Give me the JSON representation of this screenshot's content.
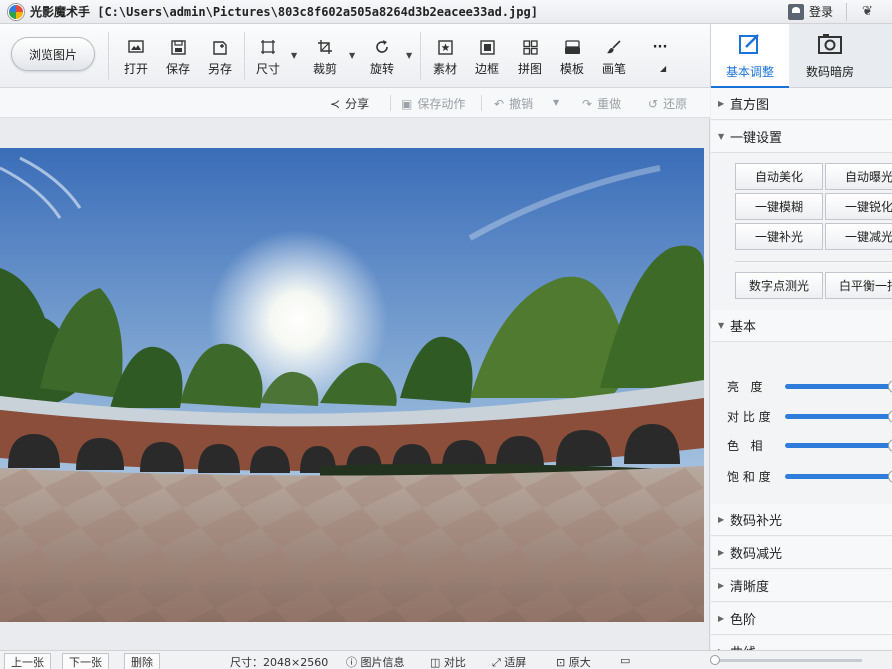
{
  "titlebar": {
    "title": "光影魔术手 [C:\\Users\\admin\\Pictures\\803c8f602a505a8264d3b2eacee33ad.jpg]",
    "login_label": "登录"
  },
  "toolbar": {
    "browse_label": "浏览图片",
    "tools": [
      {
        "label": "打开",
        "icon": "open-icon"
      },
      {
        "label": "保存",
        "icon": "save-icon"
      },
      {
        "label": "另存",
        "icon": "save-as-icon"
      },
      {
        "label": "尺寸",
        "icon": "resize-icon"
      },
      {
        "label": "裁剪",
        "icon": "crop-icon"
      },
      {
        "label": "旋转",
        "icon": "rotate-icon"
      },
      {
        "label": "素材",
        "icon": "material-icon"
      },
      {
        "label": "边框",
        "icon": "frame-icon"
      },
      {
        "label": "拼图",
        "icon": "collage-icon"
      },
      {
        "label": "模板",
        "icon": "template-icon"
      },
      {
        "label": "画笔",
        "icon": "brush-icon"
      }
    ],
    "more_label": "···"
  },
  "right_tabs": [
    {
      "label": "基本调整",
      "icon": "adjust-icon",
      "active": true
    },
    {
      "label": "数码暗房",
      "icon": "camera-icon",
      "active": false
    }
  ],
  "actions": {
    "share": "分享",
    "save_action": "保存动作",
    "undo": "撤销",
    "redo": "重做",
    "restore": "还原"
  },
  "panel": {
    "histogram": "直方图",
    "one_click": "一键设置",
    "quick_buttons": [
      "自动美化",
      "自动曝光",
      "一键模糊",
      "一键锐化",
      "一键补光",
      "一键减光"
    ],
    "extra_buttons": [
      "数字点测光",
      "白平衡一指"
    ],
    "basic": "基本",
    "sliders": [
      {
        "label": "亮   度",
        "value": 1.0
      },
      {
        "label": "对 比 度",
        "value": 1.0
      },
      {
        "label": "色   相",
        "value": 1.0
      },
      {
        "label": "饱 和 度",
        "value": 1.0
      }
    ],
    "collapsed_sections": [
      "数码补光",
      "数码减光",
      "清晰度",
      "色阶",
      "曲线"
    ]
  },
  "statusbar": {
    "prev": "上一张",
    "next": "下一张",
    "delete": "删除",
    "size": "尺寸：2048×2560",
    "info": "图片信息",
    "compare": "对比",
    "fit": "适屏",
    "original": "原大"
  },
  "colors": {
    "accent": "#1a73d9",
    "slider_fill": "#2e7ddb"
  }
}
